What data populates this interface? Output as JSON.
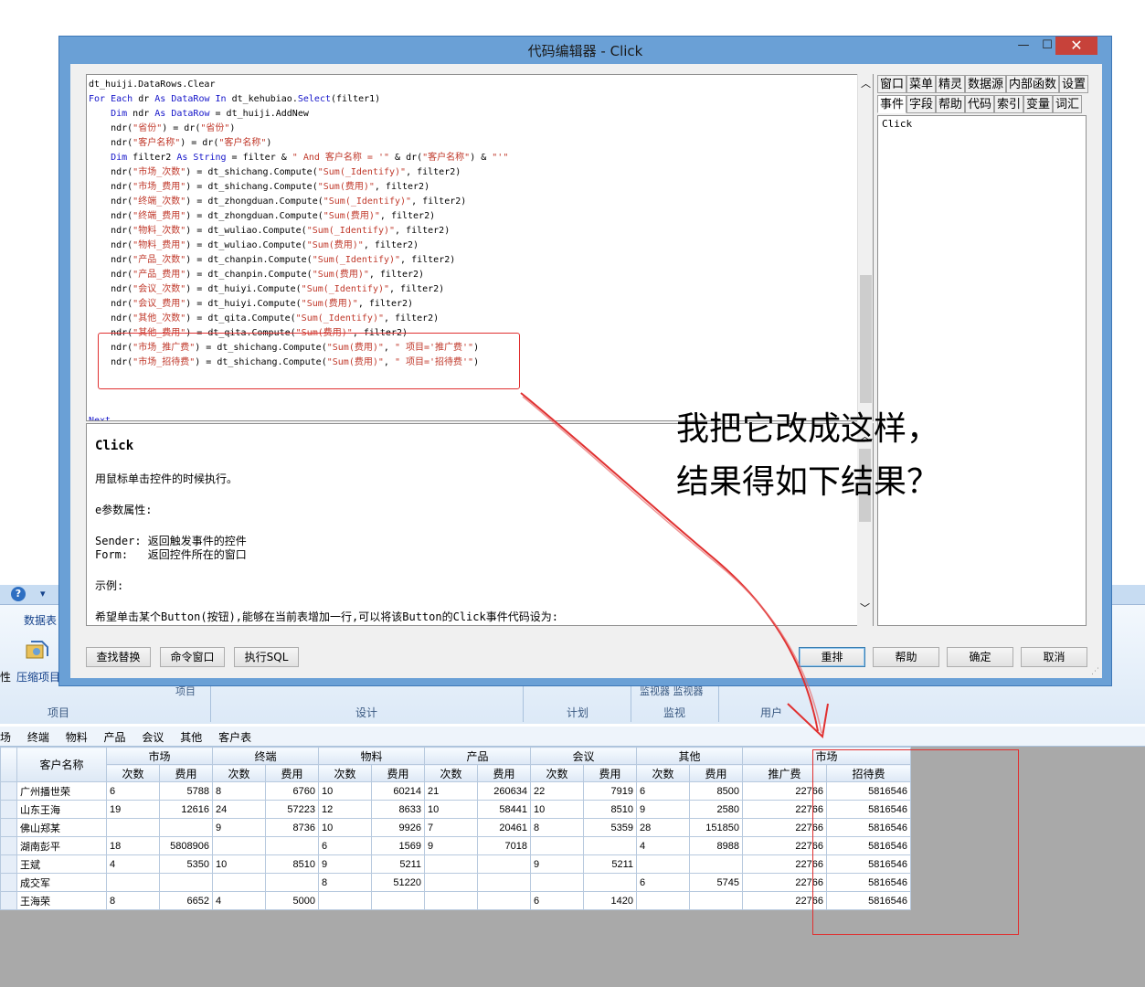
{
  "background_app": {
    "quick_access": "▾",
    "ribbon_tab": "数据表",
    "compress_button": "压缩项目",
    "left_cut": "性",
    "group_labels": [
      "项目",
      "设计",
      "计划",
      "监视",
      "用户"
    ],
    "ribbon_fragment_1": "项目",
    "ribbon_fragment_2": "监视器 监视器",
    "sub_tabs": [
      "场",
      "终端",
      "物料",
      "产品",
      "会议",
      "其他",
      "客户表"
    ],
    "grid": {
      "header_top": [
        "客户名称",
        "市场",
        "终端",
        "物料",
        "产品",
        "会议",
        "其他",
        "市场"
      ],
      "header_sub": [
        "次数",
        "费用",
        "次数",
        "费用",
        "次数",
        "费用",
        "次数",
        "费用",
        "次数",
        "费用",
        "次数",
        "费用",
        "推广费",
        "招待费"
      ],
      "rows": [
        [
          "广州播世荣",
          "6",
          "5788",
          "8",
          "6760",
          "10",
          "60214",
          "21",
          "260634",
          "22",
          "7919",
          "6",
          "8500",
          "22766",
          "5816546"
        ],
        [
          "山东王海",
          "19",
          "12616",
          "24",
          "57223",
          "12",
          "8633",
          "10",
          "58441",
          "10",
          "8510",
          "9",
          "2580",
          "22766",
          "5816546"
        ],
        [
          "佛山郑某",
          "",
          "",
          "9",
          "8736",
          "10",
          "9926",
          "7",
          "20461",
          "8",
          "5359",
          "28",
          "151850",
          "22766",
          "5816546"
        ],
        [
          "湖南彭平",
          "18",
          "5808906",
          "",
          "",
          "6",
          "1569",
          "9",
          "7018",
          "",
          "",
          "4",
          "8988",
          "22766",
          "5816546"
        ],
        [
          "王斌",
          "4",
          "5350",
          "10",
          "8510",
          "9",
          "5211",
          "",
          "",
          "9",
          "5211",
          "",
          "",
          "22766",
          "5816546"
        ],
        [
          "成交军",
          "",
          "",
          "",
          "",
          "8",
          "51220",
          "",
          "",
          "",
          "",
          "6",
          "5745",
          "22766",
          "5816546"
        ],
        [
          "王海荣",
          "8",
          "6652",
          "4",
          "5000",
          "",
          "",
          "",
          "",
          "6",
          "1420",
          "",
          "",
          "22766",
          "5816546"
        ]
      ]
    }
  },
  "dialog": {
    "title": "代码编辑器 - Click",
    "minimize": "—",
    "maximize": "☐",
    "close": "✕",
    "code_lines": [
      [
        [
          "id",
          "dt_huiji.DataRows.Clear"
        ]
      ],
      [
        [
          "kw",
          "For Each"
        ],
        [
          "id",
          " dr "
        ],
        [
          "kw",
          "As"
        ],
        [
          "id",
          " "
        ],
        [
          "kw",
          "DataRow"
        ],
        [
          "id",
          " "
        ],
        [
          "kw",
          "In"
        ],
        [
          "id",
          " dt_kehubiao."
        ],
        [
          "kw",
          "Select"
        ],
        [
          "id",
          "(filter1)"
        ]
      ],
      [
        [
          "id",
          "    "
        ],
        [
          "kw",
          "Dim"
        ],
        [
          "id",
          " ndr "
        ],
        [
          "kw",
          "As"
        ],
        [
          "id",
          " "
        ],
        [
          "kw",
          "DataRow"
        ],
        [
          "id",
          " = dt_huiji.AddNew"
        ]
      ],
      [
        [
          "id",
          "    ndr("
        ],
        [
          "str",
          "\"省份\""
        ],
        [
          "id",
          ") = dr("
        ],
        [
          "str",
          "\"省份\""
        ],
        [
          "id",
          ")"
        ]
      ],
      [
        [
          "id",
          "    ndr("
        ],
        [
          "str",
          "\"客户名称\""
        ],
        [
          "id",
          ") = dr("
        ],
        [
          "str",
          "\"客户名称\""
        ],
        [
          "id",
          ")"
        ]
      ],
      [
        [
          "id",
          "    "
        ],
        [
          "kw",
          "Dim"
        ],
        [
          "id",
          " filter2 "
        ],
        [
          "kw",
          "As String"
        ],
        [
          "id",
          " = filter & "
        ],
        [
          "str",
          "\" And 客户名称 = '\""
        ],
        [
          "id",
          " & dr("
        ],
        [
          "str",
          "\"客户名称\""
        ],
        [
          "id",
          ") & "
        ],
        [
          "str",
          "\"'\""
        ]
      ],
      [
        [
          "id",
          "    ndr("
        ],
        [
          "str",
          "\"市场_次数\""
        ],
        [
          "id",
          ") = dt_shichang.Compute("
        ],
        [
          "str",
          "\"Sum(_Identify)\""
        ],
        [
          "id",
          ", filter2)"
        ]
      ],
      [
        [
          "id",
          "    ndr("
        ],
        [
          "str",
          "\"市场_费用\""
        ],
        [
          "id",
          ") = dt_shichang.Compute("
        ],
        [
          "str",
          "\"Sum(费用)\""
        ],
        [
          "id",
          ", filter2)"
        ]
      ],
      [
        [
          "id",
          "    ndr("
        ],
        [
          "str",
          "\"终端_次数\""
        ],
        [
          "id",
          ") = dt_zhongduan.Compute("
        ],
        [
          "str",
          "\"Sum(_Identify)\""
        ],
        [
          "id",
          ", filter2)"
        ]
      ],
      [
        [
          "id",
          "    ndr("
        ],
        [
          "str",
          "\"终端_费用\""
        ],
        [
          "id",
          ") = dt_zhongduan.Compute("
        ],
        [
          "str",
          "\"Sum(费用)\""
        ],
        [
          "id",
          ", filter2)"
        ]
      ],
      [
        [
          "id",
          "    ndr("
        ],
        [
          "str",
          "\"物料_次数\""
        ],
        [
          "id",
          ") = dt_wuliao.Compute("
        ],
        [
          "str",
          "\"Sum(_Identify)\""
        ],
        [
          "id",
          ", filter2)"
        ]
      ],
      [
        [
          "id",
          "    ndr("
        ],
        [
          "str",
          "\"物料_费用\""
        ],
        [
          "id",
          ") = dt_wuliao.Compute("
        ],
        [
          "str",
          "\"Sum(费用)\""
        ],
        [
          "id",
          ", filter2)"
        ]
      ],
      [
        [
          "id",
          "    ndr("
        ],
        [
          "str",
          "\"产品_次数\""
        ],
        [
          "id",
          ") = dt_chanpin.Compute("
        ],
        [
          "str",
          "\"Sum(_Identify)\""
        ],
        [
          "id",
          ", filter2)"
        ]
      ],
      [
        [
          "id",
          "    ndr("
        ],
        [
          "str",
          "\"产品_费用\""
        ],
        [
          "id",
          ") = dt_chanpin.Compute("
        ],
        [
          "str",
          "\"Sum(费用)\""
        ],
        [
          "id",
          ", filter2)"
        ]
      ],
      [
        [
          "id",
          "    ndr("
        ],
        [
          "str",
          "\"会议_次数\""
        ],
        [
          "id",
          ") = dt_huiyi.Compute("
        ],
        [
          "str",
          "\"Sum(_Identify)\""
        ],
        [
          "id",
          ", filter2)"
        ]
      ],
      [
        [
          "id",
          "    ndr("
        ],
        [
          "str",
          "\"会议_费用\""
        ],
        [
          "id",
          ") = dt_huiyi.Compute("
        ],
        [
          "str",
          "\"Sum(费用)\""
        ],
        [
          "id",
          ", filter2)"
        ]
      ],
      [
        [
          "id",
          "    ndr("
        ],
        [
          "str",
          "\"其他_次数\""
        ],
        [
          "id",
          ") = dt_qita.Compute("
        ],
        [
          "str",
          "\"Sum(_Identify)\""
        ],
        [
          "id",
          ", filter2)"
        ]
      ],
      [
        [
          "id",
          "    ndr("
        ],
        [
          "str",
          "\"其他_费用\""
        ],
        [
          "id",
          ") = dt_qita.Compute("
        ],
        [
          "str",
          "\"Sum(费用)\""
        ],
        [
          "id",
          ", filter2)"
        ]
      ],
      [
        [
          "id",
          "    ndr("
        ],
        [
          "str",
          "\"市场_推广费\""
        ],
        [
          "id",
          ") = dt_shichang.Compute("
        ],
        [
          "str",
          "\"Sum(费用)\""
        ],
        [
          "id",
          ", "
        ],
        [
          "str",
          "\" 项目='推广费'\""
        ],
        [
          "id",
          ")"
        ]
      ],
      [
        [
          "id",
          "    ndr("
        ],
        [
          "str",
          "\"市场_招待费\""
        ],
        [
          "id",
          ") = dt_shichang.Compute("
        ],
        [
          "str",
          "\"Sum(费用)\""
        ],
        [
          "id",
          ", "
        ],
        [
          "str",
          "\" 项目='招待费'\""
        ],
        [
          "id",
          ")"
        ]
      ],
      [
        [
          "id",
          ""
        ]
      ],
      [
        [
          "id",
          ""
        ]
      ],
      [
        [
          "id",
          ""
        ]
      ],
      [
        [
          "kw",
          "Next"
        ]
      ]
    ],
    "help": {
      "title": "Click",
      "line1": "用鼠标单击控件的时候执行。",
      "line2": "e参数属性:",
      "line3": "Sender: 返回触发事件的控件",
      "line4": "Form:   返回控件所在的窗口",
      "line5": "示例:",
      "line6": "希望单击某个Button(按钮),能够在当前表增加一行,可以将该Button的Click事件代码设为:"
    },
    "tabs_row1": [
      "窗口",
      "菜单",
      "精灵",
      "数据源",
      "内部函数",
      "设置"
    ],
    "tabs_row2": [
      "事件",
      "字段",
      "帮助",
      "代码",
      "索引",
      "变量",
      "词汇"
    ],
    "event_item": "Click",
    "buttons_left": [
      "查找替换",
      "命令窗口",
      "执行SQL"
    ],
    "buttons_right": [
      "重排",
      "帮助",
      "确定",
      "取消"
    ]
  },
  "annotation": {
    "line1": "我把它改成这样，",
    "line2": "结果得如下结果？",
    "color": "#e03030"
  }
}
